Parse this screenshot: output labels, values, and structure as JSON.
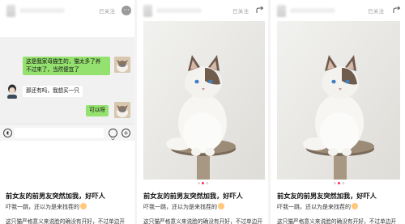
{
  "common": {
    "follow_status": "已关注",
    "title": "前女友的前男友突然加我，好吓人",
    "subtitle": "吓我一跳，还以为是来找茬的",
    "description": "这只猫严格意义来说脸的确没有开好，不过单边开"
  },
  "chat": {
    "messages": [
      {
        "from": "me",
        "text_line1": "这是我家母猫生的，猫太多了养",
        "text_line2": "不过来了，当然便宜了"
      },
      {
        "from": "them",
        "text": "那还有吗，我想买一只"
      },
      {
        "from": "me",
        "text": "可以呀"
      }
    ]
  },
  "icons": {
    "more": "more-icon",
    "share": "share-icon",
    "voice": "voice-icon",
    "emoji": "emoji-icon",
    "plus": "plus-icon"
  },
  "colors": {
    "bubble_green": "#95e16f",
    "accent_dot": "#ff2a55"
  }
}
